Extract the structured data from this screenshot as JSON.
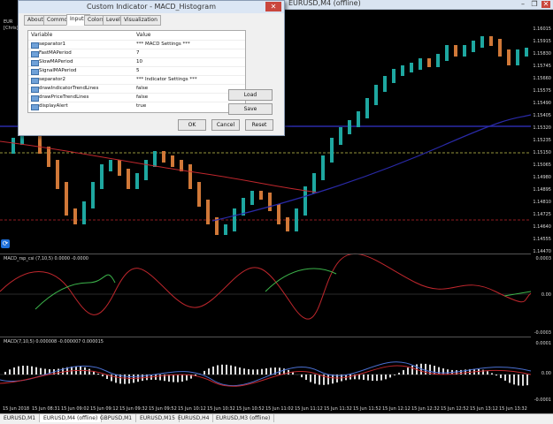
{
  "background_window": {
    "title": "EURUSD,M4 (offline)",
    "minimize": "–",
    "restore": "❐",
    "close": "✕"
  },
  "chart": {
    "left_symbol_fragment": "EUR",
    "left_label_fragment": "[Chris]",
    "price_labels": [
      "1.16015",
      "1.15915",
      "1.15830",
      "1.15745",
      "1.15660",
      "1.15575",
      "1.15490",
      "1.15405",
      "1.15320",
      "1.15235",
      "1.15150",
      "1.15065",
      "1.14980",
      "1.14895",
      "1.14810",
      "1.14725",
      "1.14640",
      "1.14555",
      "1.14470"
    ],
    "time_labels": [
      "15 Jun 2018",
      "15 Jun 08:31",
      "15 Jun 09:02",
      "15 Jun 09:12",
      "15 Jun 09:32",
      "15 Jun 09:52",
      "15 Jun 10:12",
      "15 Jun 10:32",
      "15 Jun 10:52",
      "15 Jun 11:02",
      "15 Jun 11:12",
      "15 Jun 11:32",
      "15 Jun 11:52",
      "15 Jun 12:12",
      "15 Jun 12:32",
      "15 Jun 12:52",
      "15 Jun 13:12",
      "15 Jun 13:32"
    ],
    "indicator1_label": "MACD_rsp_csi (7,10,5) 0.0000 -0.0000",
    "indicator1_scale": [
      "0.0003",
      "0.00",
      "-0.0003"
    ],
    "indicator2_label": "MACD(7,10,5) 0.000008 -0.000007 0.000015",
    "indicator2_scale": [
      "0.0001",
      "0.00",
      "-0.0001"
    ]
  },
  "tabs": [
    "EURUSD,M1",
    "EURUSD,M4 (offline)",
    "GBPUSD,M1",
    "EURUSD,M15",
    "EURUSD,H4",
    "EURUSD,M3 (offline)"
  ],
  "active_tab_index": 1,
  "dialog": {
    "title": "Custom Indicator - MACD_Histogram",
    "close": "✕",
    "tabs": [
      "About",
      "Common",
      "Inputs",
      "Colors",
      "Levels",
      "Visualization"
    ],
    "active_tab": "Inputs",
    "column_variable": "Variable",
    "column_value": "Value",
    "params": [
      {
        "name": "separator1",
        "value": "*** MACD Settings ***"
      },
      {
        "name": "FastMAPeriod",
        "value": "7"
      },
      {
        "name": "SlowMAPeriod",
        "value": "10"
      },
      {
        "name": "SignalMAPeriod",
        "value": "5"
      },
      {
        "name": "separator2",
        "value": "*** Indicator Settings ***"
      },
      {
        "name": "drawIndicatorTrendLines",
        "value": "false"
      },
      {
        "name": "drawPriceTrendLines",
        "value": "false"
      },
      {
        "name": "displayAlert",
        "value": "true"
      }
    ],
    "load_label": "Load",
    "save_label": "Save",
    "ok_label": "OK",
    "cancel_label": "Cancel",
    "reset_label": "Reset"
  },
  "colors": {
    "bull": "#1ea7a0",
    "bear": "#d07838",
    "ma_red": "#c0272d",
    "ma_blue": "#2a2aa8",
    "osc_green": "#3cb44b",
    "osc_red": "#c0272d"
  }
}
